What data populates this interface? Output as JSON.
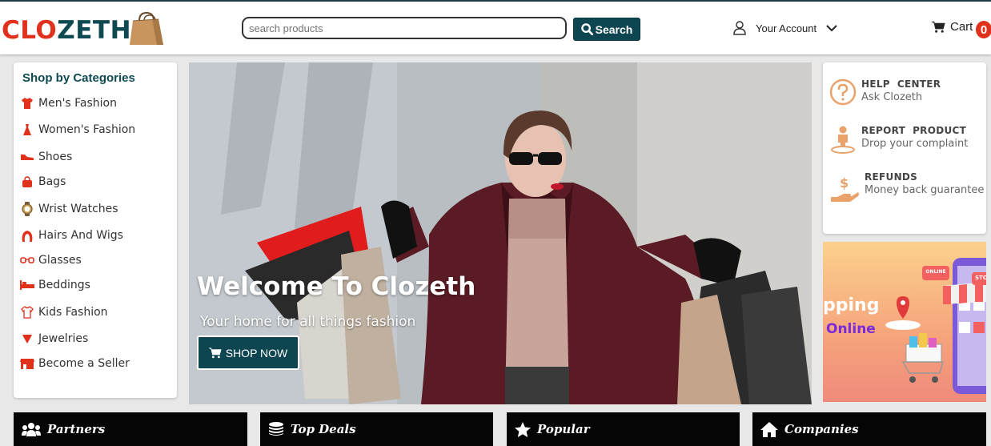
{
  "header": {
    "logo_part1": "CLO",
    "logo_part2": "ZETH",
    "search_placeholder": "search products",
    "search_button": "Search",
    "account_label": "Your Account",
    "cart_label": "Cart",
    "cart_count": "0"
  },
  "categories": {
    "title": "Shop by Categories",
    "items": [
      {
        "label": "Men's Fashion",
        "icon": "shirt-icon"
      },
      {
        "label": "Women's Fashion",
        "icon": "dress-icon"
      },
      {
        "label": "Shoes",
        "icon": "shoe-icon"
      },
      {
        "label": "Bags",
        "icon": "bag-icon"
      },
      {
        "label": "Wrist Watches",
        "icon": "watch-icon"
      },
      {
        "label": "Hairs And Wigs",
        "icon": "hair-icon"
      },
      {
        "label": "Glasses",
        "icon": "glasses-icon"
      },
      {
        "label": "Beddings",
        "icon": "bed-icon"
      },
      {
        "label": "Kids Fashion",
        "icon": "kids-shirt-icon"
      },
      {
        "label": "Jewelries",
        "icon": "jewelry-icon"
      },
      {
        "label": "Become a Seller",
        "icon": "store-icon"
      }
    ]
  },
  "hero": {
    "title": "Welcome To Clozeth",
    "subtitle": "Your home for all things fashion",
    "button": "SHOP NOW"
  },
  "help": {
    "items": [
      {
        "heading": "HELP  CENTER",
        "sub": "Ask Clozeth"
      },
      {
        "heading": "REPORT  PRODUCT",
        "sub": "Drop your complaint"
      },
      {
        "heading": "REFUNDS",
        "sub": "Money back guarantee"
      }
    ]
  },
  "promo": {
    "text1": "pping",
    "text2": "Online",
    "tag_online": "ONLINE",
    "tag_store": "STORE"
  },
  "bottom_nav": [
    {
      "label": "Partners",
      "icon": "users-icon"
    },
    {
      "label": "Top Deals",
      "icon": "coins-icon"
    },
    {
      "label": "Popular",
      "icon": "star-icon"
    },
    {
      "label": "Companies",
      "icon": "home-icon"
    }
  ],
  "colors": {
    "brand_red": "#e0311d",
    "brand_teal": "#0f4a52",
    "icon_orange": "#e8a26a"
  }
}
